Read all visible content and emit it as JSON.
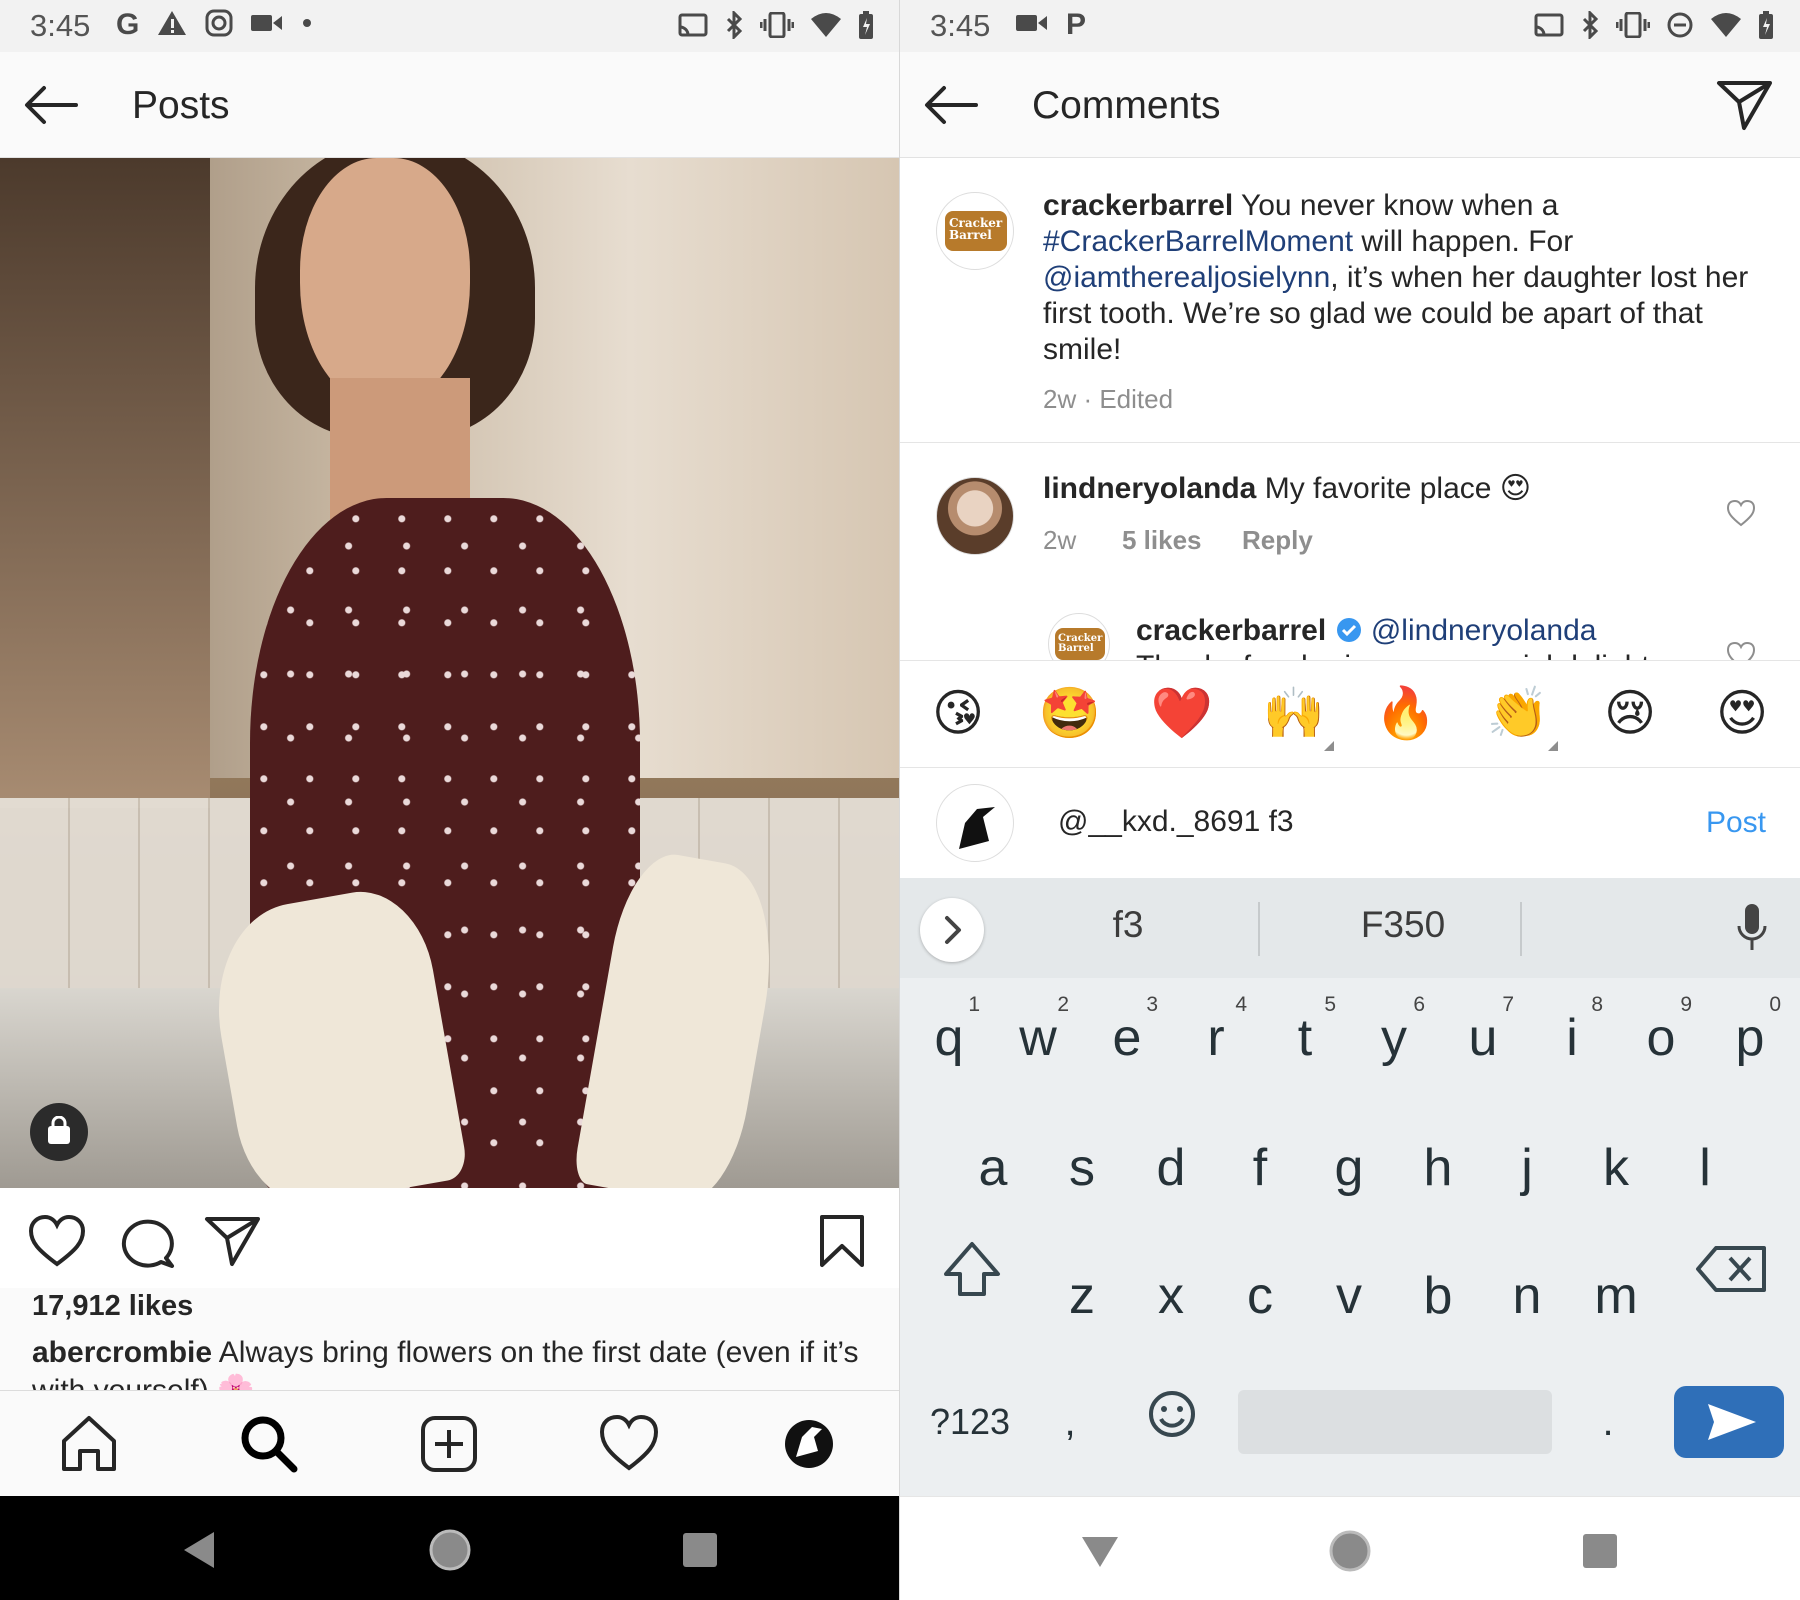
{
  "left": {
    "status_time": "3:45",
    "status_icons_left": [
      "google-icon",
      "warning-icon",
      "instagram-icon",
      "video-icon",
      "dot-icon"
    ],
    "status_icons_right": [
      "cast-icon",
      "bluetooth-icon",
      "vibrate-icon",
      "wifi-icon",
      "battery-icon"
    ],
    "header_title": "Posts",
    "post": {
      "likes": "17,912 likes",
      "caption_user": "abercrombie",
      "caption_text": "Always bring flowers on the first date (even if it’s with yourself) 🌸"
    },
    "tabs": [
      "home-tab",
      "search-tab",
      "new-post-tab",
      "activity-tab",
      "profile-tab"
    ]
  },
  "right": {
    "status_time": "3:45",
    "status_icons_left": [
      "video-icon",
      "p-app-icon"
    ],
    "status_icons_right": [
      "cast-icon",
      "bluetooth-icon",
      "vibrate-icon",
      "do-not-disturb-icon",
      "wifi-icon",
      "battery-icon"
    ],
    "header_title": "Comments",
    "original_post": {
      "user": "crackerbarrel",
      "text_1": " You never know when a ",
      "hashtag": "#CrackerBarrelMoment",
      "text_2": " will happen. For ",
      "mention": "@iamtherealjosielynn",
      "text_3": ", it’s when her daughter lost her first tooth. We’re so glad we could be apart of that smile!",
      "meta": "2w · Edited"
    },
    "comments": [
      {
        "user": "lindneryolanda",
        "text": " My favorite place 😍",
        "time": "2w",
        "likes": "5 likes",
        "reply": "Reply"
      }
    ],
    "reply": {
      "user": "crackerbarrel",
      "mention": "@lindneryolanda",
      "text_partial": "Thanks for sharing your special delight"
    },
    "emoji_bar": [
      "😘",
      "🤩",
      "❤️",
      "🙌",
      "🔥",
      "👏",
      "😢",
      "😍"
    ],
    "composer": {
      "value": "@__kxd._8691 f3",
      "post_label": "Post"
    },
    "keyboard": {
      "suggestions": [
        "f3",
        "F350"
      ],
      "row1": [
        "q",
        "w",
        "e",
        "r",
        "t",
        "y",
        "u",
        "i",
        "o",
        "p"
      ],
      "row1_hints": [
        "1",
        "2",
        "3",
        "4",
        "5",
        "6",
        "7",
        "8",
        "9",
        "0"
      ],
      "row2": [
        "a",
        "s",
        "d",
        "f",
        "g",
        "h",
        "j",
        "k",
        "l"
      ],
      "row3": [
        "z",
        "x",
        "c",
        "v",
        "b",
        "n",
        "m"
      ],
      "symbols_label": "?123",
      "comma": ",",
      "period": "."
    },
    "colors": {
      "link": "#1f3f78",
      "post_button": "#3897f0",
      "send_key": "#2f6fb8"
    }
  }
}
